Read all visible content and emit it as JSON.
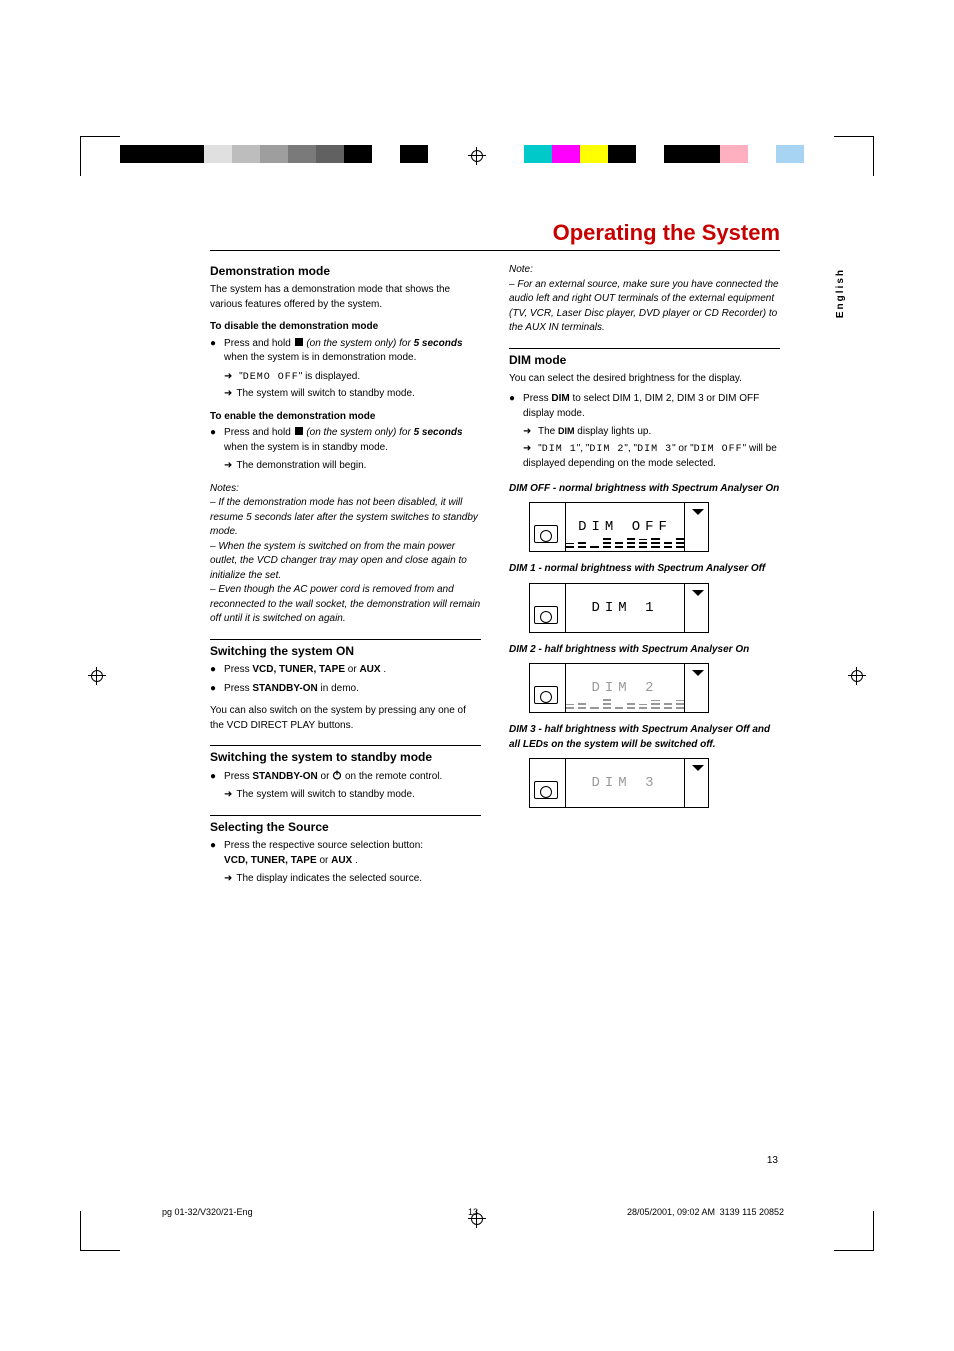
{
  "page_title": "Operating the System",
  "language_tab": "English",
  "page_number": "13",
  "footer": {
    "left": "pg 01-32/V320/21-Eng",
    "center": "13",
    "right_date": "28/05/2001, 09:02 AM",
    "right_code": "3139 115 20852"
  },
  "left_column": {
    "demo_mode": {
      "heading": "Demonstration mode",
      "intro": "The system has a demonstration mode that shows the various features offered by the system.",
      "disable_heading": "To disable the demonstration mode",
      "disable_press": "Press and hold ",
      "disable_press_after": " (on the system only) for ",
      "disable_seconds": "5 seconds",
      "disable_tail": " when the system is in demonstration mode.",
      "disable_result1_pre": "\"",
      "disable_result1_seg": "DEMO OFF",
      "disable_result1_post": "\" is displayed.",
      "disable_result2": "The system will switch to standby mode.",
      "enable_heading": "To enable the demonstration mode",
      "enable_press": "Press and hold ",
      "enable_press_after": " (on the system only) for ",
      "enable_seconds": "5 seconds",
      "enable_tail": " when the system is in standby mode.",
      "enable_result": "The demonstration will begin.",
      "notes_label": "Notes:",
      "note1": "– If the demonstration mode has not been disabled, it will resume 5 seconds later after the system switches to standby mode.",
      "note2": "– When the system is switched on from the main power outlet, the VCD changer tray may open and close again to initialize the set.",
      "note3": "– Even though the AC power cord is removed from and reconnected to the wall socket, the demonstration will remain off until it is switched on again."
    },
    "switch_on": {
      "heading": "Switching the system ON",
      "line1_pre": "Press ",
      "line1_items": "VCD, TUNER, TAPE",
      "line1_or": " or ",
      "line1_last": "AUX",
      "line1_end": ".",
      "line2_pre": "Press ",
      "line2_btn": "STANDBY-ON",
      "line2_end": " in demo.",
      "para": "You can also switch on the system by pressing any one of the VCD DIRECT PLAY buttons."
    },
    "switch_standby": {
      "heading": "Switching the system to standby mode",
      "line_pre": "Press ",
      "line_btn": "STANDBY-ON",
      "line_or": " or ",
      "line_end": " on the remote control.",
      "result": "The system will switch to standby mode."
    },
    "selecting": {
      "heading": "Selecting the Source",
      "line": "Press the respective source selection button:",
      "items": "VCD, TUNER, TAPE",
      "or": " or ",
      "last": "AUX",
      "end": ".",
      "result": "The display indicates the selected source."
    }
  },
  "right_column": {
    "note_label": "Note:",
    "note_body": "– For an external source, make sure you have connected the audio left and right OUT terminals of the external equipment (TV, VCR, Laser Disc player, DVD player or CD Recorder) to the AUX IN terminals.",
    "dim": {
      "heading": "DIM mode",
      "intro": "You can select the desired brightness for the display.",
      "press_pre": "Press ",
      "press_btn": "DIM",
      "press_post": " to select DIM 1, DIM 2, DIM 3 or DIM OFF display mode.",
      "result1_pre": "The ",
      "result1_mid": "DIM",
      "result1_post": " display lights up.",
      "result2_pre": "\"",
      "seg1": "DIM 1",
      "mid1": "\", \"",
      "seg2": "DIM 2",
      "mid2": "\", \"",
      "seg3": "DIM 3",
      "mid3": "\" or \"",
      "seg4": "DIM OFF",
      "result2_post": "\" will be displayed depending on the mode selected.",
      "dim_off_label": "DIM OFF - normal brightness with Spectrum Analyser On",
      "dim_off_disp": "DIM OFF",
      "dim1_label": "DIM 1 - normal brightness with Spectrum Analyser Off",
      "dim1_disp": "DIM 1",
      "dim2_label": "DIM 2 - half brightness with Spectrum Analyser On",
      "dim2_disp": "DIM 2",
      "dim3_label": "DIM 3 - half brightness with Spectrum Analyser Off and all LEDs on the system will be switched off.",
      "dim3_disp": "DIM 3"
    }
  },
  "reg_colors_left": [
    "#000",
    "#000",
    "#000",
    "#e0e0e0",
    "#bdbdbd",
    "#9e9e9e",
    "#7a7a7a",
    "#616161",
    "#000",
    "#fff",
    "#000"
  ],
  "reg_colors_right": [
    "#00c9c9",
    "#ff00ff",
    "#ffff00",
    "#000",
    "#fff",
    "#000",
    "#000",
    "#ffb0c0",
    "#fff",
    "#a6d4f2"
  ]
}
